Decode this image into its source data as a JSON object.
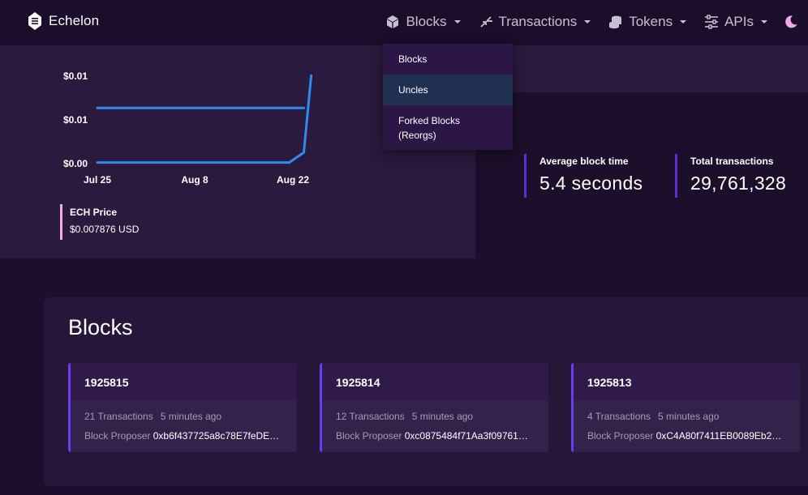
{
  "app": {
    "name": "Echelon"
  },
  "nav": {
    "items": [
      {
        "label": "Blocks",
        "icon": "cube-icon"
      },
      {
        "label": "Transactions",
        "icon": "transfer-arrows-icon"
      },
      {
        "label": "Tokens",
        "icon": "coins-icon"
      },
      {
        "label": "APIs",
        "icon": "sliders-icon"
      }
    ],
    "theme_icon": "moon-icon"
  },
  "dropdown": {
    "items": [
      {
        "label": "Blocks"
      },
      {
        "label": "Uncles"
      },
      {
        "label": "Forked Blocks (Reorgs)"
      }
    ]
  },
  "chart_data": {
    "type": "line",
    "title": "",
    "xlabel": "",
    "ylabel": "",
    "x_ticks": [
      "Jul 25",
      "Aug 8",
      "Aug 22"
    ],
    "y_ticks": [
      "$0.00",
      "$0.01",
      "$0.01"
    ],
    "series": [
      {
        "name": "",
        "color": "#2e8bf0",
        "x": [
          "Jul 25",
          "Aug 1",
          "Aug 8",
          "Aug 15",
          "Aug 20",
          "Aug 22",
          "Aug 23"
        ],
        "values": [
          0.0001,
          0.0001,
          0.0001,
          0.0001,
          0.0001,
          0.001,
          0.0079
        ]
      },
      {
        "name": "",
        "color": "#2e8bf0",
        "x": [
          "Jul 25",
          "Aug 1",
          "Aug 8",
          "Aug 15",
          "Aug 22"
        ],
        "values": [
          0.005,
          0.005,
          0.005,
          0.005,
          0.005
        ]
      }
    ],
    "ylim": [
      0,
      0.008
    ],
    "grid": false
  },
  "price": {
    "label": "ECH Price",
    "value": "$0.007876 USD",
    "accent": "#f3a8e8"
  },
  "stats": [
    {
      "label": "Average block time",
      "value": "5.4 seconds"
    },
    {
      "label": "Total transactions",
      "value": "29,761,328"
    }
  ],
  "blocks": {
    "title": "Blocks",
    "items": [
      {
        "number": "1925815",
        "transactions": "21 Transactions",
        "time": "5 minutes ago",
        "proposer_label": "Block Proposer",
        "proposer": "0xb6f437725a8c78E7feDE…"
      },
      {
        "number": "1925814",
        "transactions": "12 Transactions",
        "time": "5 minutes ago",
        "proposer_label": "Block Proposer",
        "proposer": "0xc0875484f71Aa3f09761…"
      },
      {
        "number": "1925813",
        "transactions": "4 Transactions",
        "time": "5 minutes ago",
        "proposer_label": "Block Proposer",
        "proposer": "0xC4A80f7411EB0089Eb2…"
      }
    ]
  },
  "colors": {
    "background": "#1b0f2b",
    "card": "#2a1a3d",
    "accent": "#5b2ed8",
    "line": "#2e8bf0"
  }
}
